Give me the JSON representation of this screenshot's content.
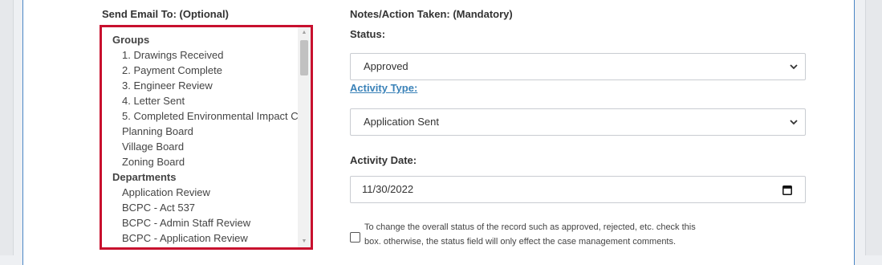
{
  "send_email": {
    "label": "Send Email To: (Optional)",
    "list": {
      "group_header_groups": "Groups",
      "groups": [
        "1. Drawings Received",
        "2. Payment Complete",
        "3. Engineer Review",
        "4. Letter Sent",
        "5. Completed Environmental Impact C",
        "Planning Board",
        "Village Board",
        "Zoning Board"
      ],
      "group_header_departments": "Departments",
      "departments": [
        "Application Review",
        "BCPC - Act 537",
        "BCPC - Admin Staff Review",
        "BCPC - Application Review"
      ]
    }
  },
  "notes": {
    "label": "Notes/Action Taken: (Mandatory)",
    "status_label": "Status:",
    "status_value": "Approved",
    "activity_type_label": "Activity Type:",
    "activity_type_value": "Application Sent",
    "activity_date_label": "Activity Date:",
    "activity_date_value": "11/30/2022",
    "checkbox_text": "To change the overall status of the record such as approved, rejected, etc. check this box. otherwise, the status field will only effect the case management comments."
  },
  "colors": {
    "highlight_border": "#c8102e",
    "link": "#3a82b8",
    "panel_border": "#4a86c5"
  },
  "icons": [
    "chevron-down-icon",
    "calendar-icon",
    "scroll-up-arrow-icon",
    "scroll-down-arrow-icon"
  ]
}
